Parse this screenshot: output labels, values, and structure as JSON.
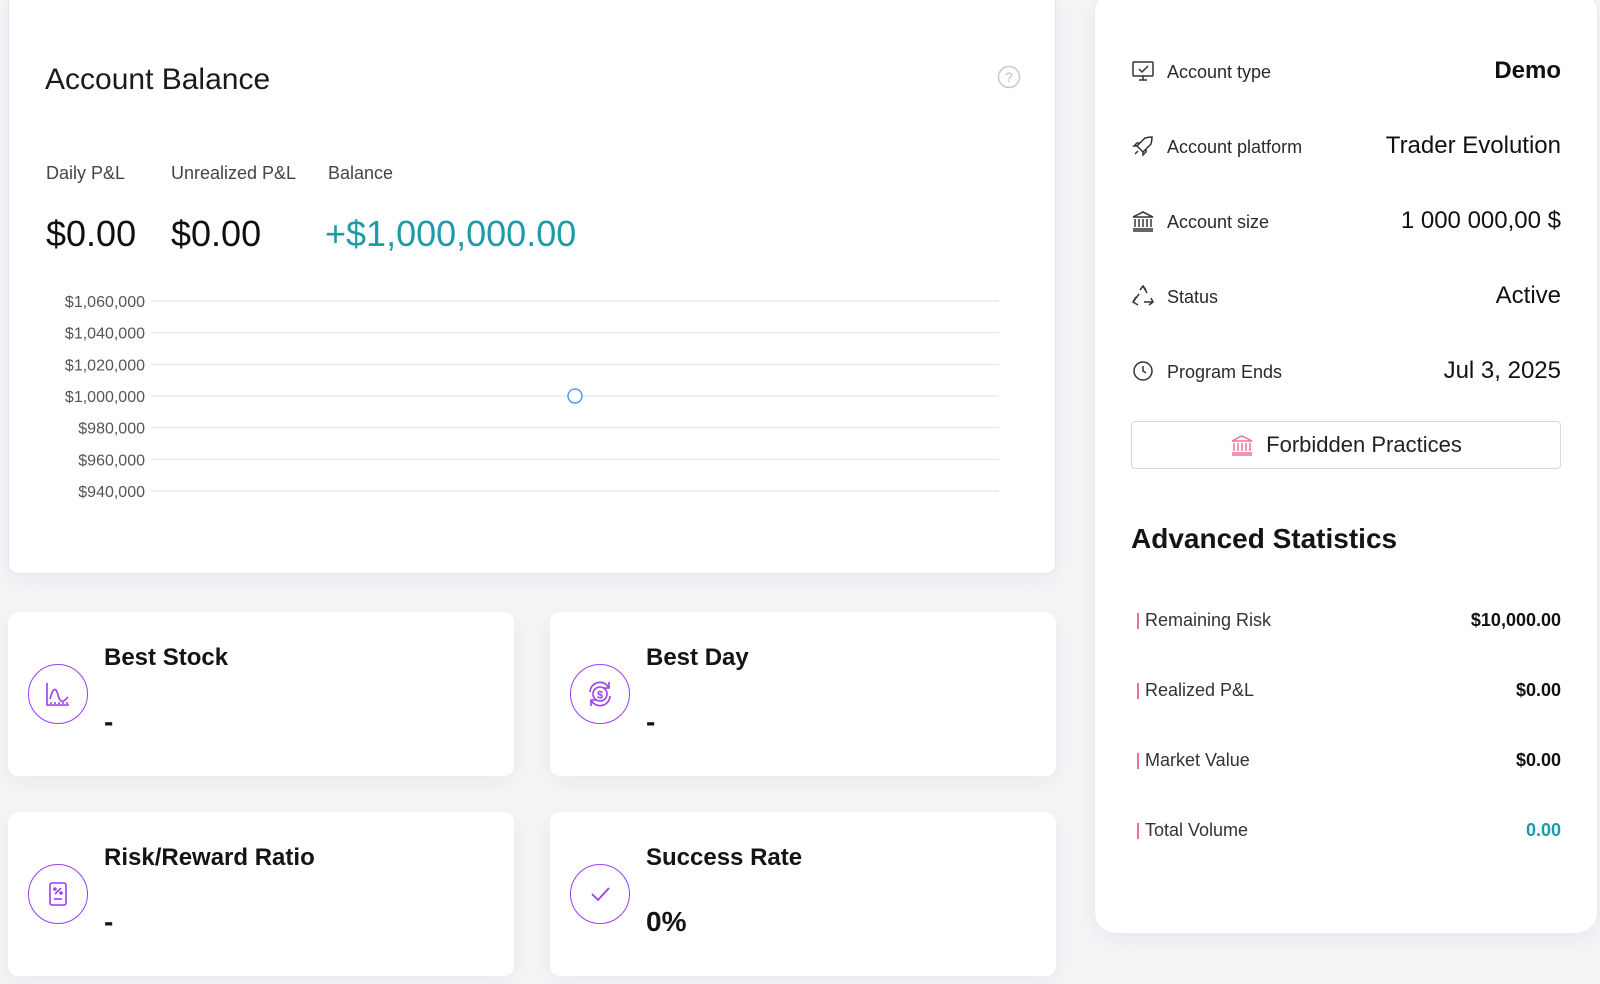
{
  "balance": {
    "title": "Account Balance",
    "metrics": [
      {
        "label": "Daily P&L",
        "value": "$0.00"
      },
      {
        "label": "Unrealized P&L",
        "value": "$0.00"
      },
      {
        "label": "Balance",
        "value": "+$1,000,000.00"
      }
    ]
  },
  "chart_data": {
    "type": "line",
    "title": "",
    "xlabel": "",
    "ylabel": "",
    "ylim": [
      940000,
      1060000
    ],
    "y_ticks": [
      "$1,060,000",
      "$1,040,000",
      "$1,020,000",
      "$1,000,000",
      "$980,000",
      "$960,000",
      "$940,000"
    ],
    "y_tick_values": [
      1060000,
      1040000,
      1020000,
      1000000,
      980000,
      960000,
      940000
    ],
    "series": [
      {
        "values": [
          1000000
        ]
      }
    ],
    "grid": true,
    "colors": {
      "point": "#5b9be3",
      "grid": "#e3e3ea"
    }
  },
  "stats": [
    {
      "title": "Best Stock",
      "value": "-",
      "icon": "chart-curve-icon"
    },
    {
      "title": "Best Day",
      "value": "-",
      "icon": "dollar-cycle-icon"
    },
    {
      "title": "Risk/Reward Ratio",
      "value": "-",
      "icon": "percent-document-icon"
    },
    {
      "title": "Success Rate",
      "value": "0%",
      "icon": "check-icon"
    }
  ],
  "account": {
    "rows": [
      {
        "label": "Account type",
        "value": "Demo",
        "icon": "monitor-icon"
      },
      {
        "label": "Account platform",
        "value": "Trader Evolution",
        "icon": "rocket-icon"
      },
      {
        "label": "Account size",
        "value": "1 000 000,00 $",
        "icon": "bank-icon"
      },
      {
        "label": "Status",
        "value": "Active",
        "icon": "recycle-icon"
      },
      {
        "label": "Program Ends",
        "value": "Jul 3, 2025",
        "icon": "clock-icon"
      }
    ],
    "forbidden_label": "Forbidden Practices"
  },
  "advanced": {
    "title": "Advanced Statistics",
    "rows": [
      {
        "label": "Remaining Risk",
        "value": "$10,000.00"
      },
      {
        "label": "Realized P&L",
        "value": "$0.00"
      },
      {
        "label": "Market Value",
        "value": "$0.00"
      },
      {
        "label": "Total Volume",
        "value": "0.00"
      }
    ]
  },
  "colors": {
    "accent_teal": "#1e9aa8",
    "accent_purple": "#9b3df0",
    "accent_pink": "#f0709a"
  }
}
